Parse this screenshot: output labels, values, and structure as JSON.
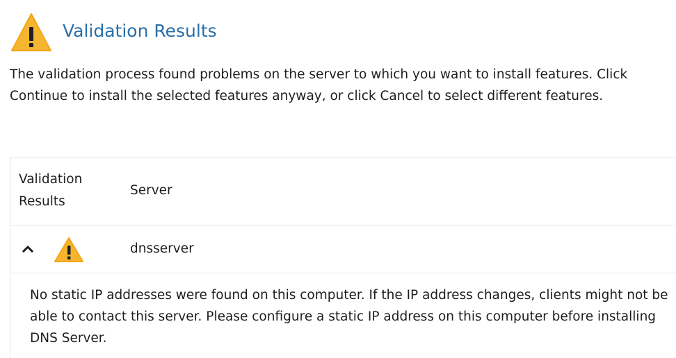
{
  "header": {
    "title": "Validation Results",
    "icon": "warning-icon"
  },
  "description": "The validation process found problems on the server to which you want to install features. Click Continue to install the selected features anyway, or click Cancel to select different features.",
  "table": {
    "columns": [
      "Validation Results",
      "Server"
    ],
    "rows": [
      {
        "status_icon": "warning-icon",
        "expanded": true,
        "server": "dnsserver",
        "message": "No static IP addresses were found on this computer. If the IP address changes, clients might not be able to contact this server. Please configure a static IP address on this computer before installing DNS Server."
      }
    ]
  },
  "colors": {
    "accent": "#2a6fa8",
    "warning": "#f6b531",
    "border": "#e6e6e6"
  }
}
